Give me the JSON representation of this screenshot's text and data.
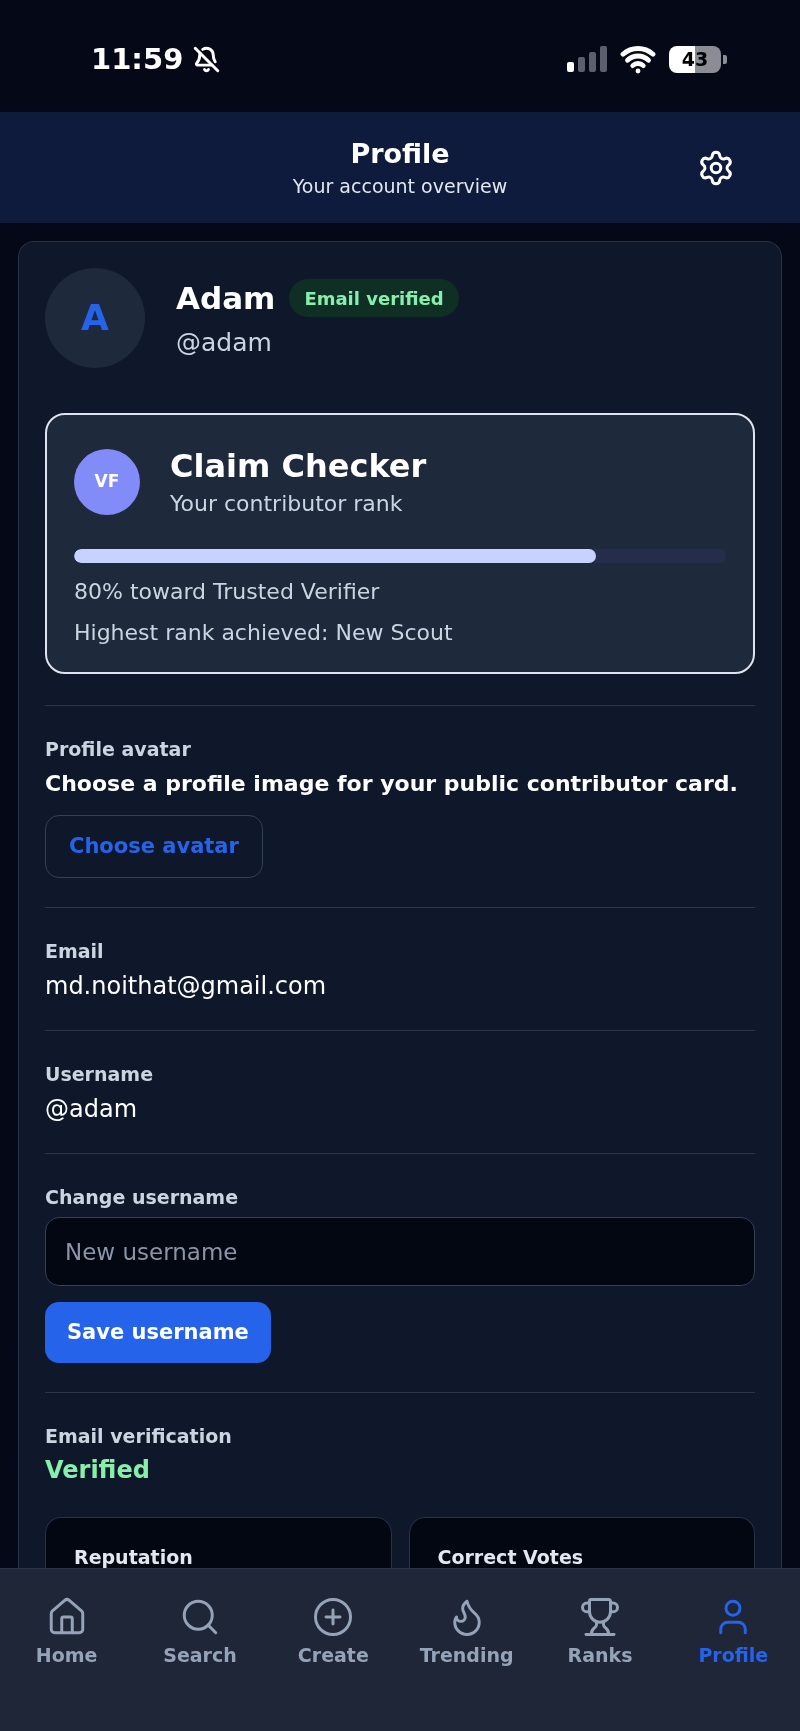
{
  "status_bar": {
    "time": "11:59",
    "silent": true,
    "battery": "43"
  },
  "header": {
    "title": "Profile",
    "subtitle": "Your account overview"
  },
  "profile": {
    "avatar_initial": "A",
    "name": "Adam",
    "badge": "Email verified",
    "handle": "@adam"
  },
  "rank_card": {
    "initials": "VF",
    "title": "Claim Checker",
    "subtitle": "Your contributor rank",
    "level": 0.8,
    "progress_text": "80% toward Trusted Verifier",
    "highest_rank": "Highest rank achieved: New Scout"
  },
  "sections": [
    {
      "kind": "avatar",
      "label": "Profile avatar",
      "description": "Choose a profile image for your public contributor card.",
      "button": "Choose avatar"
    },
    {
      "kind": "info",
      "label": "Email",
      "value": "md.noithat@gmail.com"
    },
    {
      "kind": "info",
      "label": "Username",
      "value": "@adam"
    },
    {
      "kind": "input",
      "label": "Change username",
      "placeholder": "New username",
      "button": "Save username"
    },
    {
      "kind": "status",
      "label": "Email verification",
      "value": "Verified"
    }
  ],
  "stats": [
    {
      "label": "Reputation"
    },
    {
      "label": "Correct Votes"
    }
  ],
  "tab_bar": [
    {
      "label": "Home",
      "selected": false
    },
    {
      "label": "Search",
      "selected": false
    },
    {
      "label": "Create",
      "selected": false
    },
    {
      "label": "Trending",
      "selected": false
    },
    {
      "label": "Ranks",
      "selected": false
    },
    {
      "label": "Profile",
      "selected": true
    }
  ]
}
